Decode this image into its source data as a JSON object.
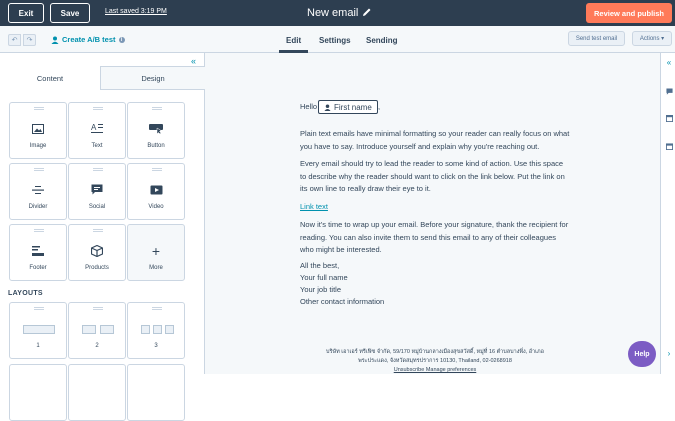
{
  "header": {
    "exit_label": "Exit",
    "save_label": "Save",
    "last_saved": "Last saved 3:19 PM",
    "email_title": "New email",
    "publish_label": "Review and publish"
  },
  "toolbar": {
    "ab_test_label": "Create A/B test",
    "tabs": [
      "Edit",
      "Settings",
      "Sending"
    ],
    "active_tab": "Edit",
    "send_test_label": "Send test email",
    "actions_label": "Actions ▾"
  },
  "left_panel": {
    "tabs": [
      "Content",
      "Design"
    ],
    "active_tab": "Content",
    "modules": [
      {
        "label": "Image",
        "icon": "image-icon"
      },
      {
        "label": "Text",
        "icon": "text-icon"
      },
      {
        "label": "Button",
        "icon": "button-icon"
      },
      {
        "label": "Divider",
        "icon": "divider-icon"
      },
      {
        "label": "Social",
        "icon": "social-icon"
      },
      {
        "label": "Video",
        "icon": "video-icon"
      },
      {
        "label": "Footer",
        "icon": "footer-icon"
      },
      {
        "label": "Products",
        "icon": "products-icon"
      },
      {
        "label": "More",
        "icon": "plus-icon"
      }
    ],
    "layouts_title": "LAYOUTS",
    "layouts": [
      {
        "label": "1",
        "columns": 1
      },
      {
        "label": "2",
        "columns": 2
      },
      {
        "label": "3",
        "columns": 3
      }
    ]
  },
  "email_body": {
    "greeting": "Hello",
    "personalization_token": "First name",
    "greeting_suffix": ",",
    "paragraph1": "Plain text emails have minimal formatting so your reader can really focus on what you have to say. Introduce yourself and explain why you're reaching out.",
    "paragraph2": "Every email should try to lead the reader to some kind of action. Use this space to describe why the reader should want to click on the link below. Put the link on its own line to really draw their eye to it.",
    "link_text": "Link text",
    "paragraph3": "Now it's time to wrap up your email. Before your signature, thank the recipient for reading. You can also invite them to send this email to any of their colleagues who might be interested.",
    "signoff": "All the best,",
    "name": "Your full name",
    "job_title": "Your job title",
    "contact": "Other contact information",
    "footer_line1": "บริษัท เอาเอร์ ทรีเฟิซ จำกัด, 59/170 หมู่บ้านกลางเมืองสุขสวัสดิ์, หมู่ที่ 16 ตำบลบางพึ่ง, อำเภอ",
    "footer_line2": "พระประแดง, จังหวัดสมุทรปราการ 10130, Thailand, 02-0268918",
    "footer_links": "Unsubscribe Manage preferences"
  },
  "help_label": "Help",
  "colors": {
    "topbar": "#2d3e50",
    "accent": "#ff7a59",
    "link": "#0091ae",
    "help": "#7c5cc4"
  }
}
